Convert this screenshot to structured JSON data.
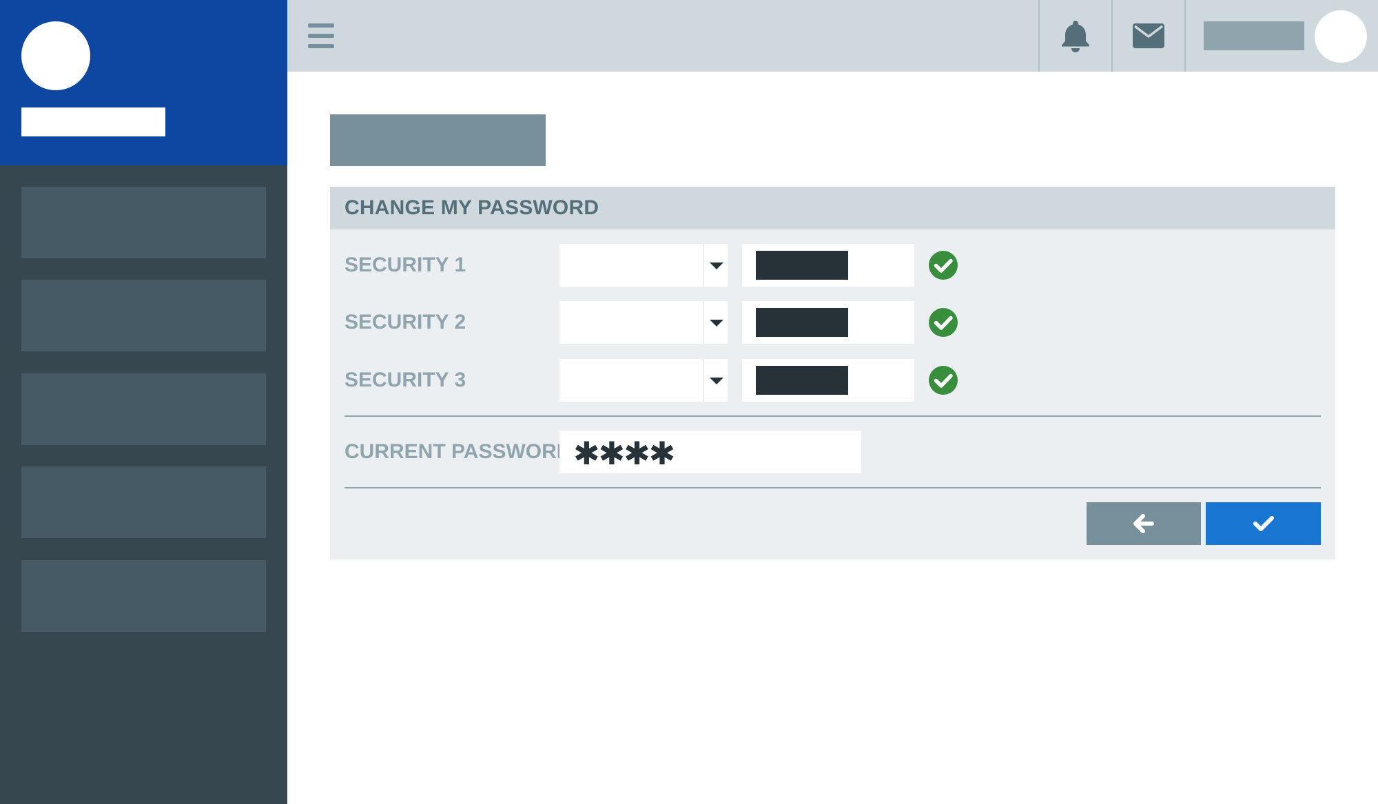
{
  "colors": {
    "sidebar_bg": "#37474f",
    "sidebar_header_bg": "#0d47a1",
    "sidebar_item_bg": "#455a64",
    "topbar_bg": "#cfd8dc",
    "panel_bg": "#eceff1",
    "label_color": "#90a4ae",
    "title_color": "#546e7a",
    "success_green": "#388e3c",
    "confirm_blue": "#1976d2",
    "back_gray": "#78909c"
  },
  "topbar": {
    "icons": [
      "menu-icon",
      "bell-icon",
      "envelope-icon",
      "user-avatar"
    ]
  },
  "form": {
    "title": "CHANGE MY PASSWORD",
    "security_questions": [
      {
        "label": "SECURITY 1",
        "status_icon": "check-circle-icon"
      },
      {
        "label": "SECURITY 2",
        "status_icon": "check-circle-icon"
      },
      {
        "label": "SECURITY 3",
        "status_icon": "check-circle-icon"
      }
    ],
    "current_password": {
      "label": "CURRENT PASSWORD",
      "value": "✱✱✱✱"
    },
    "buttons": {
      "back_icon": "arrow-left-icon",
      "confirm_icon": "checkmark-icon"
    }
  }
}
